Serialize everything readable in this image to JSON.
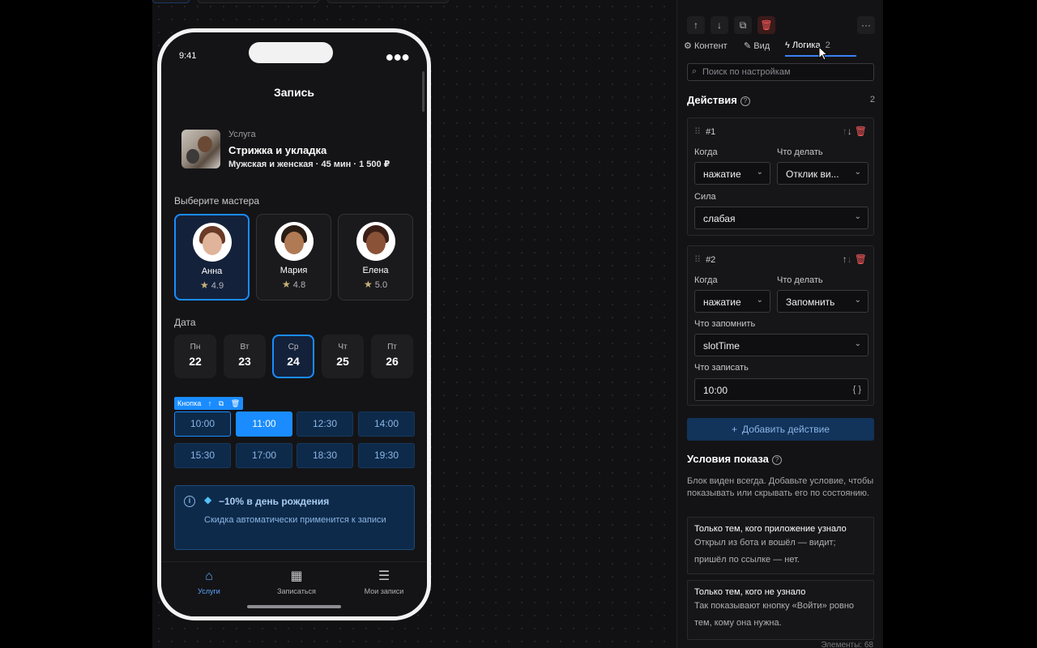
{
  "phone": {
    "time": "9:41",
    "title": "Запись",
    "service": {
      "kicker": "Услуга",
      "name": "Стрижка и укладка",
      "meta": "Мужская и женская · 45 мин · 1 500 ₽"
    },
    "masters_label": "Выберите мастера",
    "masters": [
      {
        "name": "Анна",
        "rating": "4.9",
        "selected": true
      },
      {
        "name": "Мария",
        "rating": "4.8",
        "selected": false
      },
      {
        "name": "Елена",
        "rating": "5.0",
        "selected": false
      }
    ],
    "date_label": "Дата",
    "dates": [
      {
        "dow": "Пн",
        "day": "22"
      },
      {
        "dow": "Вт",
        "day": "23"
      },
      {
        "dow": "Ср",
        "day": "24",
        "selected": true
      },
      {
        "dow": "Чт",
        "day": "25"
      },
      {
        "dow": "Пт",
        "day": "26"
      }
    ],
    "button_badge": "Кнопка",
    "slots": [
      "10:00",
      "11:00",
      "12:30",
      "14:00",
      "15:30",
      "17:00",
      "18:30",
      "19:30"
    ],
    "selected_slot": "11:00",
    "promo": {
      "title": "−10% в день рождения",
      "text": "Скидка автоматически применится к записи"
    },
    "tabs": [
      {
        "label": "Услуги",
        "icon": "home-icon",
        "active": true
      },
      {
        "label": "Записаться",
        "icon": "calendar-icon",
        "active": false
      },
      {
        "label": "Мои записи",
        "icon": "list-icon",
        "active": false
      }
    ]
  },
  "panel": {
    "tabs": [
      {
        "label": "Контент",
        "icon": "gear-icon"
      },
      {
        "label": "Вид",
        "icon": "brush-icon"
      },
      {
        "label": "Логика",
        "icon": "bolt-icon",
        "count": "2",
        "active": true
      }
    ],
    "search_placeholder": "Поиск по настройкам",
    "actions_title": "Действия",
    "actions_count": "2",
    "actions": [
      {
        "num": "#1",
        "when_label": "Когда",
        "when_value": "нажатие",
        "what_label": "Что делать",
        "what_value": "Отклик ви...",
        "extra_label": "Сила",
        "extra_value": "слабая"
      },
      {
        "num": "#2",
        "when_label": "Когда",
        "when_value": "нажатие",
        "what_label": "Что делать",
        "what_value": "Запомнить",
        "remember_label": "Что запомнить",
        "remember_value": "slotTime",
        "write_label": "Что записать",
        "write_value": "10:00",
        "write_suffix": "{ }"
      }
    ],
    "add_action": "Добавить действие",
    "conditions_title": "Условия показа",
    "conditions_desc": "Блок виден всегда. Добавьте условие, чтобы показывать или скрывать его по состоянию.",
    "conditions": [
      {
        "title": "Только тем, кого приложение узнало",
        "desc": "Открыл из бота и вошёл — видит; пришёл по ссылке — нет."
      },
      {
        "title": "Только тем, кого не узнало",
        "desc": "Так показывают кнопку «Войти» ровно тем, кому она нужна."
      }
    ],
    "footer": "Элементы: 68"
  },
  "colors": {
    "accent": "#1a8cff",
    "danger": "#ff5b5b",
    "slot_bg": "#0e2a4a"
  }
}
